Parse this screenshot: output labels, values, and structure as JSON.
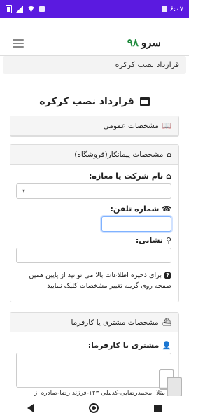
{
  "status_bar": {
    "time": "۶:۰۷",
    "bg_color": "#5b1ae0"
  },
  "header": {
    "brand_word": "سرو",
    "brand_number": "۹۸",
    "menu_icon": "hamburger-icon"
  },
  "breadcrumb": "قرارداد نصب کرکره",
  "page_title": "قرارداد نصب کرکره",
  "sections": {
    "general": {
      "title": "مشخصات عمومی",
      "icon": "book-icon"
    },
    "contractor": {
      "title": "مشخصات پیمانکار(فروشگاه)",
      "icon": "home-icon",
      "company_label": "نام شرکت یا مغازه:",
      "phone_label": "شماره تلفن:",
      "address_label": "نشانی:",
      "note": "برای ذخیره اطلاعات بالا می توانید از پایین همین صفحه روی گزینه تغییر مشخصات کلیک نمایید"
    },
    "customer": {
      "title": "مشخصات مشتری یا کارفرما",
      "icon": "ship-icon",
      "customer_label": "مشتری یا کارفرما:",
      "example": "مثلا: محمدرضایی-کدملی ۱۲۳-فرزند رضا-صادره از"
    }
  },
  "colors": {
    "brand_green": "#1e8a3c",
    "focus_blue": "#7fb2ff"
  }
}
